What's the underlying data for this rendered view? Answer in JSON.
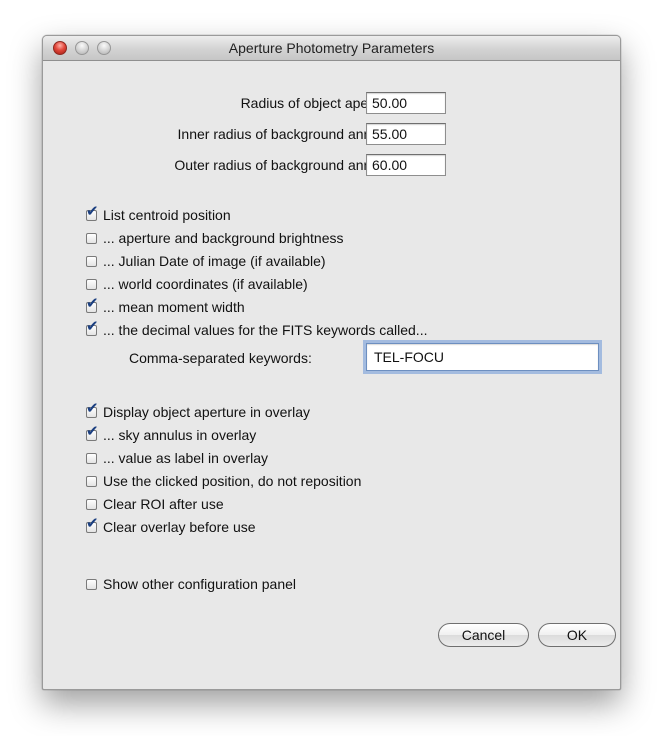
{
  "window": {
    "title": "Aperture Photometry Parameters"
  },
  "fields": [
    {
      "label": "Radius of object aperture",
      "value": "50.00"
    },
    {
      "label": "Inner radius of background annulus",
      "value": "55.00"
    },
    {
      "label": "Outer radius of background annulus",
      "value": "60.00"
    }
  ],
  "list_options": [
    {
      "label": "List centroid position",
      "checked": true
    },
    {
      "label": "... aperture and background brightness",
      "checked": false
    },
    {
      "label": "... Julian Date of image (if available)",
      "checked": false
    },
    {
      "label": "... world coordinates (if available)",
      "checked": false
    },
    {
      "label": "... mean moment width",
      "checked": true
    },
    {
      "label": "... the decimal values for the FITS keywords called...",
      "checked": true
    }
  ],
  "keywords": {
    "label": "Comma-separated keywords:",
    "value": "TEL-FOCU"
  },
  "overlay_options": [
    {
      "label": "Display object aperture in overlay",
      "checked": true
    },
    {
      "label": "... sky annulus in overlay",
      "checked": true
    },
    {
      "label": "... value as label in overlay",
      "checked": false
    },
    {
      "label": "Use the clicked position, do not reposition",
      "checked": false
    },
    {
      "label": "Clear ROI after use",
      "checked": false
    },
    {
      "label": "Clear overlay before use",
      "checked": true
    }
  ],
  "other_panel": {
    "label": "Show other configuration panel",
    "checked": false
  },
  "buttons": {
    "cancel": "Cancel",
    "ok": "OK"
  },
  "colors": {
    "close_button": "#e2483c",
    "checkmark": "#1b3f80",
    "focus_ring": "#6996d7"
  }
}
